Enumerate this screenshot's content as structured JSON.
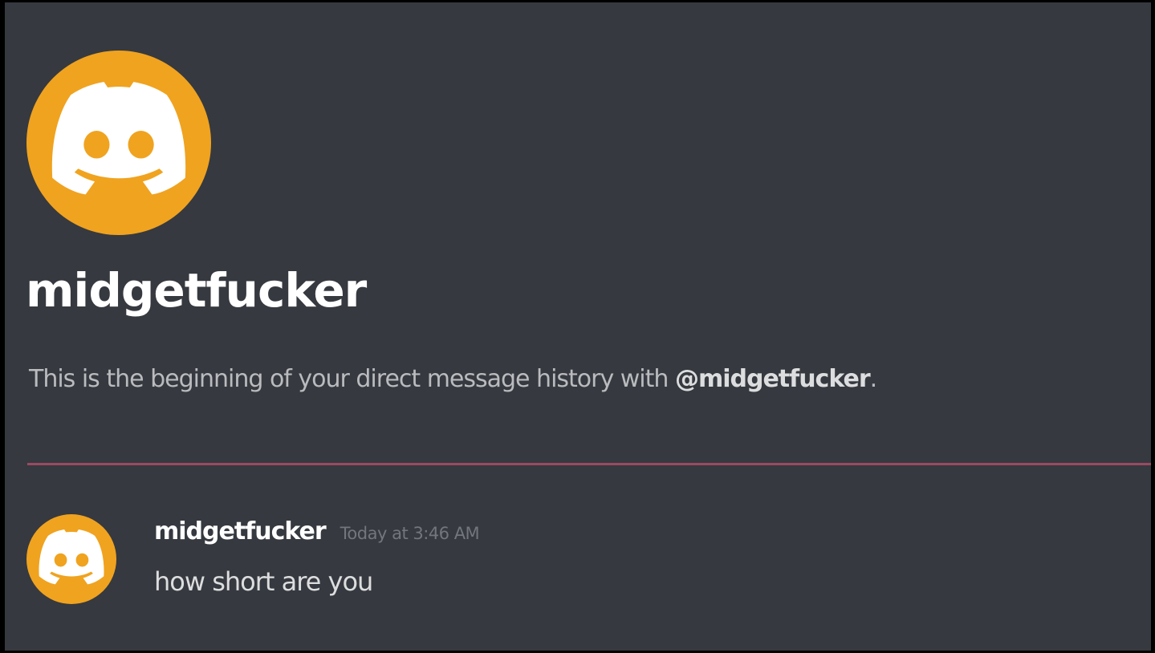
{
  "dm": {
    "title": "midgetfucker",
    "intro_text": "This is the beginning of your direct message history with ",
    "intro_mention": "@midgetfucker",
    "intro_suffix": "."
  },
  "message": {
    "author": "midgetfucker",
    "timestamp": "Today at 3:46 AM",
    "text": "how short are you"
  },
  "colors": {
    "background": "#36393f",
    "avatar": "#f0a31f",
    "divider": "#9a4a62"
  },
  "icons": {
    "avatar": "discord-logo-icon"
  }
}
